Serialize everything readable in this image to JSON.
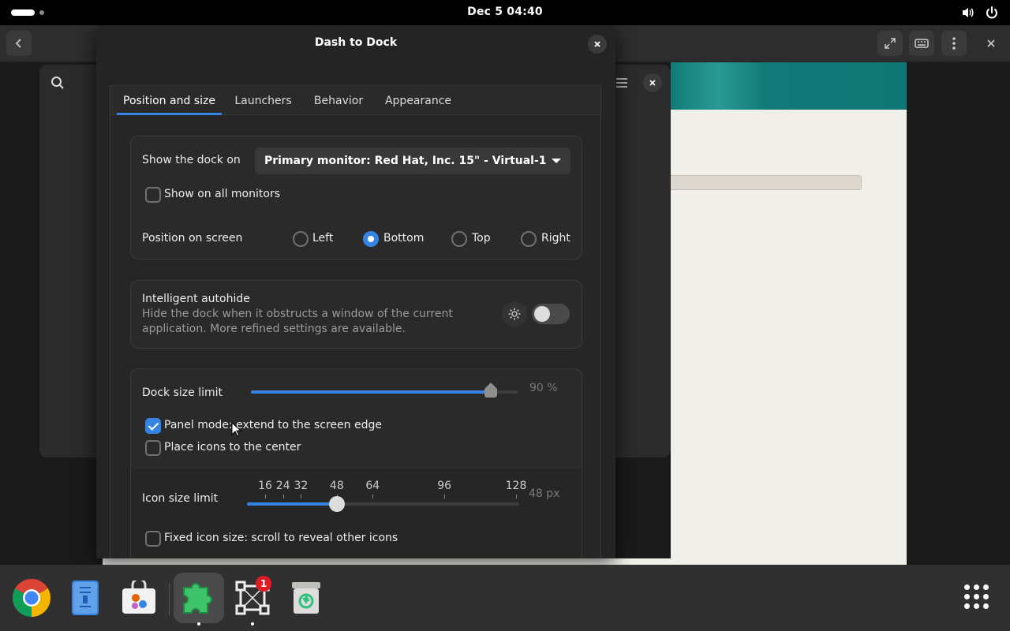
{
  "topbar": {
    "clock": "Dec 5  04:40"
  },
  "dialog": {
    "title": "Dash to Dock",
    "tabs": [
      {
        "label": "Position and size",
        "active": true
      },
      {
        "label": "Launchers",
        "active": false
      },
      {
        "label": "Behavior",
        "active": false
      },
      {
        "label": "Appearance",
        "active": false
      }
    ],
    "position": {
      "show_dock_label": "Show the dock on",
      "monitor_selected": "Primary monitor: Red Hat, Inc. 15\" - Virtual-1",
      "all_monitors_label": "Show on all monitors",
      "all_monitors_checked": false,
      "position_label": "Position on screen",
      "options": [
        "Left",
        "Bottom",
        "Top",
        "Right"
      ],
      "selected": "Bottom"
    },
    "autohide": {
      "title": "Intelligent autohide",
      "description_line1": "Hide the dock when it obstructs a window of the current",
      "description_line2": "application. More refined settings are available.",
      "enabled": false
    },
    "size": {
      "dock_size_label": "Dock size limit",
      "dock_size_value": "90 %",
      "dock_size_fraction": 0.9,
      "panel_mode_label": "Panel mode: extend to the screen edge",
      "panel_mode_checked": true,
      "center_icons_label": "Place icons to the center",
      "center_icons_checked": false,
      "icon_size_label": "Icon size limit",
      "icon_size_value": "48 px",
      "icon_size_ticks": [
        "16",
        "24",
        "32",
        "48",
        "64",
        "96",
        "128"
      ],
      "icon_size_current": 48,
      "fixed_icon_label": "Fixed icon size: scroll to reveal other icons",
      "fixed_icon_checked": false
    }
  },
  "dock": {
    "items": [
      {
        "name": "chrome",
        "running": false
      },
      {
        "name": "text-editor",
        "running": false
      },
      {
        "name": "software",
        "running": false
      },
      {
        "name": "extensions",
        "running": true,
        "focused": true
      },
      {
        "name": "screenshot-tool",
        "running": true,
        "badge": "1"
      },
      {
        "name": "trash",
        "running": false
      }
    ]
  },
  "colors": {
    "accent": "#3584e4",
    "dialog_bg": "#242424",
    "dock_bg": "#303030",
    "web_header": "#117a78"
  }
}
